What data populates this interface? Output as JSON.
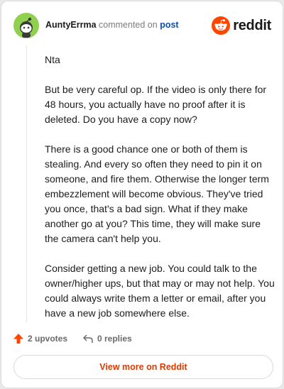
{
  "header": {
    "username": "AuntyErrma",
    "action_text": "commented on",
    "post_link": "post",
    "brand": "reddit"
  },
  "comment": {
    "paragraphs": [
      "Nta",
      "But be very careful op. If the video is only there for 48 hours, you actually have no proof after it is deleted. Do you have a copy now?",
      "There is a good chance one or both of them is stealing. And every so often they need to pin it on someone, and fire them. Otherwise the longer term embezzlement will become obvious. They've tried you once, that's a bad sign. What if they make another go at you? This time, they will make sure the camera can't help you.",
      "Consider getting a new job. You could talk to the owner/higher ups, but that may or may not help. You could always write them a letter or email, after you have a new job somewhere else."
    ]
  },
  "actions": {
    "upvotes": "2 upvotes",
    "replies": "0 replies"
  },
  "footer": {
    "view_more": "View more on Reddit"
  },
  "colors": {
    "brand_orange": "#ff4500",
    "link_blue": "#0b4fa8",
    "avatar_green": "#8fd14f",
    "view_more_text": "#d93a00"
  }
}
